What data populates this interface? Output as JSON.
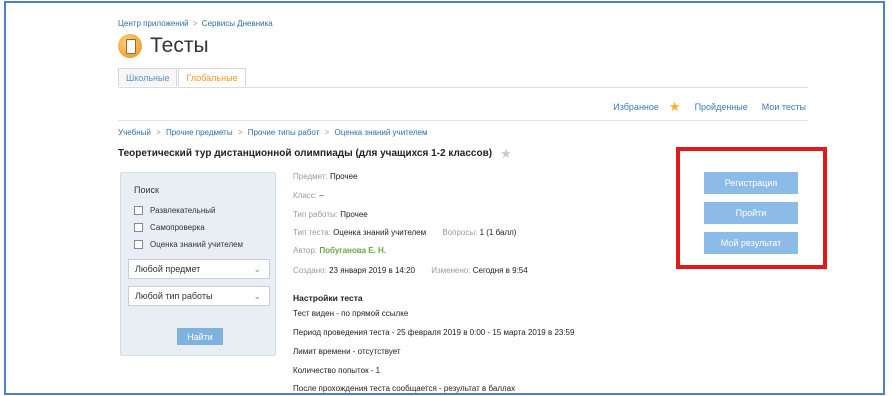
{
  "breadcrumb_top": {
    "item1": "Центр приложений",
    "sep": ">",
    "item2": "Сервисы Дневника"
  },
  "page_title": "Тесты",
  "tabs": [
    {
      "label": "Школьные"
    },
    {
      "label": "Глобальные"
    }
  ],
  "top_nav": {
    "favorites": "Избранное",
    "completed": "Пройденные",
    "my_tests": "Мои тесты"
  },
  "breadcrumb_sub": [
    "Учебный",
    "Прочие предметы",
    "Прочие типы работ",
    "Оценка знаний учителем"
  ],
  "breadcrumb_sep": ">",
  "test_title": "Теоретический тур дистанционной олимпиады (для учащихся 1-2 классов)",
  "search": {
    "title": "Поиск",
    "checkboxes": [
      "Развлекательный",
      "Самопроверка",
      "Оценка знаний учителем"
    ],
    "subject_select": "Любой предмет",
    "worktype_select": "Любой тип работы",
    "find_button": "Найти"
  },
  "info": {
    "subject_label": "Предмет:",
    "subject_value": "Прочее",
    "class_label": "Класс:",
    "class_value": "–",
    "worktype_label": "Тип работы:",
    "worktype_value": "Прочее",
    "testtype_label": "Тип теста:",
    "testtype_value": "Оценка знаний учителем",
    "questions_label": "Вопросы:",
    "questions_value": "1 (1 балл)",
    "author_label": "Автор:",
    "author_value": "Побуганова Е. Н.",
    "created_label": "Создано:",
    "created_value": "23 января 2019 в 14:20",
    "changed_label": "Изменено:",
    "changed_value": "Сегодня в 9:54"
  },
  "settings": {
    "title": "Настройки теста",
    "lines": [
      "Тест виден - по прямой ссылке",
      "Период проведения теста - 25 февраля 2019 в 0:00 - 15 марта 2019 в 23:59",
      "Лимит времени - отсутствует",
      "Количество попыток - 1",
      "После прохождения теста сообщается - результат в баллах"
    ]
  },
  "actions": {
    "register": "Регистрация",
    "pass": "Пройти",
    "my_result": "Мой результат"
  },
  "colors": {
    "highlight_box": "#e0191b",
    "button_bg": "#8bbbe6",
    "link": "#3d7ab5",
    "active_tab": "#f29a1e"
  }
}
